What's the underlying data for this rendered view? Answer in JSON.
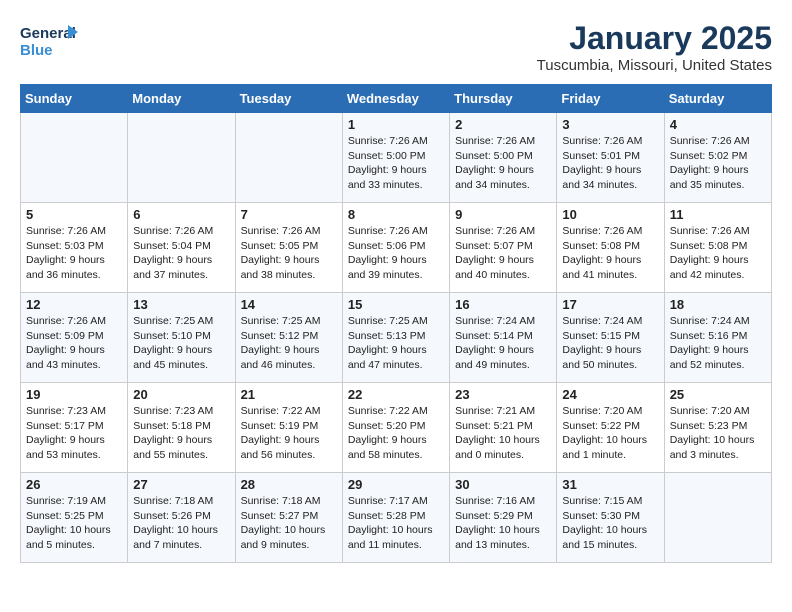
{
  "logo": {
    "line1": "General",
    "line2": "Blue"
  },
  "title": "January 2025",
  "subtitle": "Tuscumbia, Missouri, United States",
  "weekdays": [
    "Sunday",
    "Monday",
    "Tuesday",
    "Wednesday",
    "Thursday",
    "Friday",
    "Saturday"
  ],
  "weeks": [
    [
      {
        "day": "",
        "info": ""
      },
      {
        "day": "",
        "info": ""
      },
      {
        "day": "",
        "info": ""
      },
      {
        "day": "1",
        "info": "Sunrise: 7:26 AM\nSunset: 5:00 PM\nDaylight: 9 hours\nand 33 minutes."
      },
      {
        "day": "2",
        "info": "Sunrise: 7:26 AM\nSunset: 5:00 PM\nDaylight: 9 hours\nand 34 minutes."
      },
      {
        "day": "3",
        "info": "Sunrise: 7:26 AM\nSunset: 5:01 PM\nDaylight: 9 hours\nand 34 minutes."
      },
      {
        "day": "4",
        "info": "Sunrise: 7:26 AM\nSunset: 5:02 PM\nDaylight: 9 hours\nand 35 minutes."
      }
    ],
    [
      {
        "day": "5",
        "info": "Sunrise: 7:26 AM\nSunset: 5:03 PM\nDaylight: 9 hours\nand 36 minutes."
      },
      {
        "day": "6",
        "info": "Sunrise: 7:26 AM\nSunset: 5:04 PM\nDaylight: 9 hours\nand 37 minutes."
      },
      {
        "day": "7",
        "info": "Sunrise: 7:26 AM\nSunset: 5:05 PM\nDaylight: 9 hours\nand 38 minutes."
      },
      {
        "day": "8",
        "info": "Sunrise: 7:26 AM\nSunset: 5:06 PM\nDaylight: 9 hours\nand 39 minutes."
      },
      {
        "day": "9",
        "info": "Sunrise: 7:26 AM\nSunset: 5:07 PM\nDaylight: 9 hours\nand 40 minutes."
      },
      {
        "day": "10",
        "info": "Sunrise: 7:26 AM\nSunset: 5:08 PM\nDaylight: 9 hours\nand 41 minutes."
      },
      {
        "day": "11",
        "info": "Sunrise: 7:26 AM\nSunset: 5:08 PM\nDaylight: 9 hours\nand 42 minutes."
      }
    ],
    [
      {
        "day": "12",
        "info": "Sunrise: 7:26 AM\nSunset: 5:09 PM\nDaylight: 9 hours\nand 43 minutes."
      },
      {
        "day": "13",
        "info": "Sunrise: 7:25 AM\nSunset: 5:10 PM\nDaylight: 9 hours\nand 45 minutes."
      },
      {
        "day": "14",
        "info": "Sunrise: 7:25 AM\nSunset: 5:12 PM\nDaylight: 9 hours\nand 46 minutes."
      },
      {
        "day": "15",
        "info": "Sunrise: 7:25 AM\nSunset: 5:13 PM\nDaylight: 9 hours\nand 47 minutes."
      },
      {
        "day": "16",
        "info": "Sunrise: 7:24 AM\nSunset: 5:14 PM\nDaylight: 9 hours\nand 49 minutes."
      },
      {
        "day": "17",
        "info": "Sunrise: 7:24 AM\nSunset: 5:15 PM\nDaylight: 9 hours\nand 50 minutes."
      },
      {
        "day": "18",
        "info": "Sunrise: 7:24 AM\nSunset: 5:16 PM\nDaylight: 9 hours\nand 52 minutes."
      }
    ],
    [
      {
        "day": "19",
        "info": "Sunrise: 7:23 AM\nSunset: 5:17 PM\nDaylight: 9 hours\nand 53 minutes."
      },
      {
        "day": "20",
        "info": "Sunrise: 7:23 AM\nSunset: 5:18 PM\nDaylight: 9 hours\nand 55 minutes."
      },
      {
        "day": "21",
        "info": "Sunrise: 7:22 AM\nSunset: 5:19 PM\nDaylight: 9 hours\nand 56 minutes."
      },
      {
        "day": "22",
        "info": "Sunrise: 7:22 AM\nSunset: 5:20 PM\nDaylight: 9 hours\nand 58 minutes."
      },
      {
        "day": "23",
        "info": "Sunrise: 7:21 AM\nSunset: 5:21 PM\nDaylight: 10 hours\nand 0 minutes."
      },
      {
        "day": "24",
        "info": "Sunrise: 7:20 AM\nSunset: 5:22 PM\nDaylight: 10 hours\nand 1 minute."
      },
      {
        "day": "25",
        "info": "Sunrise: 7:20 AM\nSunset: 5:23 PM\nDaylight: 10 hours\nand 3 minutes."
      }
    ],
    [
      {
        "day": "26",
        "info": "Sunrise: 7:19 AM\nSunset: 5:25 PM\nDaylight: 10 hours\nand 5 minutes."
      },
      {
        "day": "27",
        "info": "Sunrise: 7:18 AM\nSunset: 5:26 PM\nDaylight: 10 hours\nand 7 minutes."
      },
      {
        "day": "28",
        "info": "Sunrise: 7:18 AM\nSunset: 5:27 PM\nDaylight: 10 hours\nand 9 minutes."
      },
      {
        "day": "29",
        "info": "Sunrise: 7:17 AM\nSunset: 5:28 PM\nDaylight: 10 hours\nand 11 minutes."
      },
      {
        "day": "30",
        "info": "Sunrise: 7:16 AM\nSunset: 5:29 PM\nDaylight: 10 hours\nand 13 minutes."
      },
      {
        "day": "31",
        "info": "Sunrise: 7:15 AM\nSunset: 5:30 PM\nDaylight: 10 hours\nand 15 minutes."
      },
      {
        "day": "",
        "info": ""
      }
    ]
  ]
}
